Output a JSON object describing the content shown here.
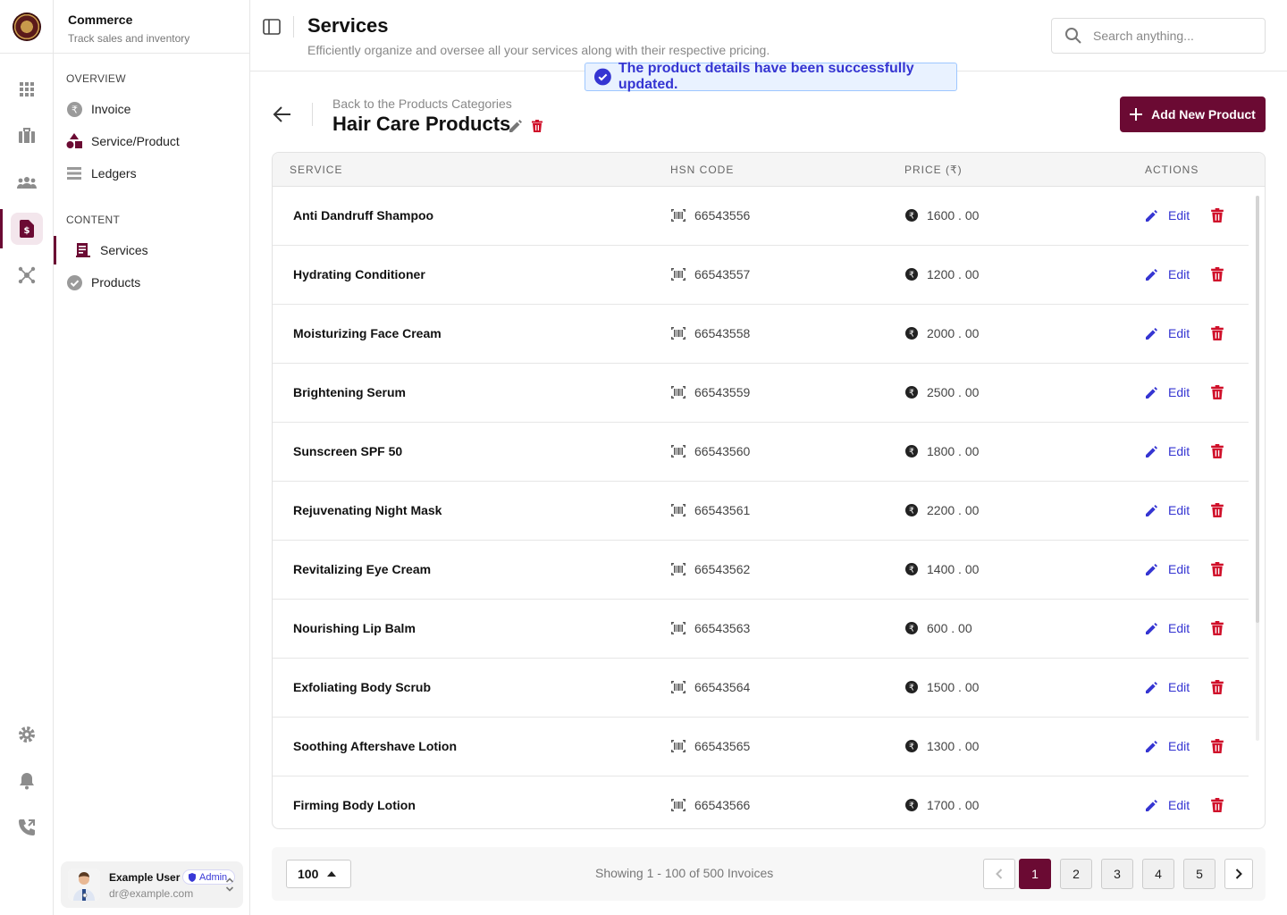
{
  "app": {
    "name": "Commerce",
    "tagline": "Track sales and inventory"
  },
  "sidebar": {
    "overview_label": "OVERVIEW",
    "content_label": "CONTENT",
    "overview_items": [
      {
        "label": "Invoice",
        "icon": "rupee-circle-icon"
      },
      {
        "label": "Service/Product",
        "icon": "shapes-icon"
      },
      {
        "label": "Ledgers",
        "icon": "list-icon"
      }
    ],
    "content_items": [
      {
        "label": "Services",
        "icon": "receipt-icon",
        "active": true
      },
      {
        "label": "Products",
        "icon": "check-circle-icon"
      }
    ]
  },
  "user": {
    "name": "Example User",
    "email": "dr@example.com",
    "role": "Admin"
  },
  "header": {
    "title": "Services",
    "subtitle": "Efficiently organize and oversee all your services along with their respective pricing.",
    "search_placeholder": "Search anything..."
  },
  "toast": {
    "message": "The product details have been successfully updated."
  },
  "category": {
    "breadcrumb": "Back to the Products Categories",
    "title": "Hair Care Products"
  },
  "actions": {
    "add_label": "Add New Product"
  },
  "table": {
    "columns": {
      "service": "SERVICE",
      "hsn": "HSN CODE",
      "price": "PRICE (₹)",
      "actions": "ACTIONS"
    },
    "edit_label": "Edit",
    "rows": [
      {
        "name": "Anti Dandruff Shampoo",
        "hsn": "66543556",
        "price": "1600 . 00"
      },
      {
        "name": "Hydrating Conditioner",
        "hsn": "66543557",
        "price": "1200 . 00"
      },
      {
        "name": "Moisturizing Face Cream",
        "hsn": "66543558",
        "price": "2000 . 00"
      },
      {
        "name": "Brightening Serum",
        "hsn": "66543559",
        "price": "2500 . 00"
      },
      {
        "name": "Sunscreen SPF 50",
        "hsn": "66543560",
        "price": "1800 . 00"
      },
      {
        "name": "Rejuvenating Night Mask",
        "hsn": "66543561",
        "price": "2200 . 00"
      },
      {
        "name": "Revitalizing Eye Cream",
        "hsn": "66543562",
        "price": "1400 . 00"
      },
      {
        "name": "Nourishing Lip Balm",
        "hsn": "66543563",
        "price": "600 . 00"
      },
      {
        "name": "Exfoliating Body Scrub",
        "hsn": "66543564",
        "price": "1500 . 00"
      },
      {
        "name": "Soothing Aftershave Lotion",
        "hsn": "66543565",
        "price": "1300 . 00"
      },
      {
        "name": "Firming Body Lotion",
        "hsn": "66543566",
        "price": "1700 . 00"
      }
    ]
  },
  "pagination": {
    "per_page": "100",
    "summary": "Showing 1 - 100 of 500 Invoices",
    "pages": [
      "1",
      "2",
      "3",
      "4",
      "5"
    ],
    "current": "1"
  },
  "colors": {
    "brand": "#6b0a33",
    "link": "#3535d2",
    "danger": "#d0102a",
    "toast_bg": "#e9f2ff"
  }
}
